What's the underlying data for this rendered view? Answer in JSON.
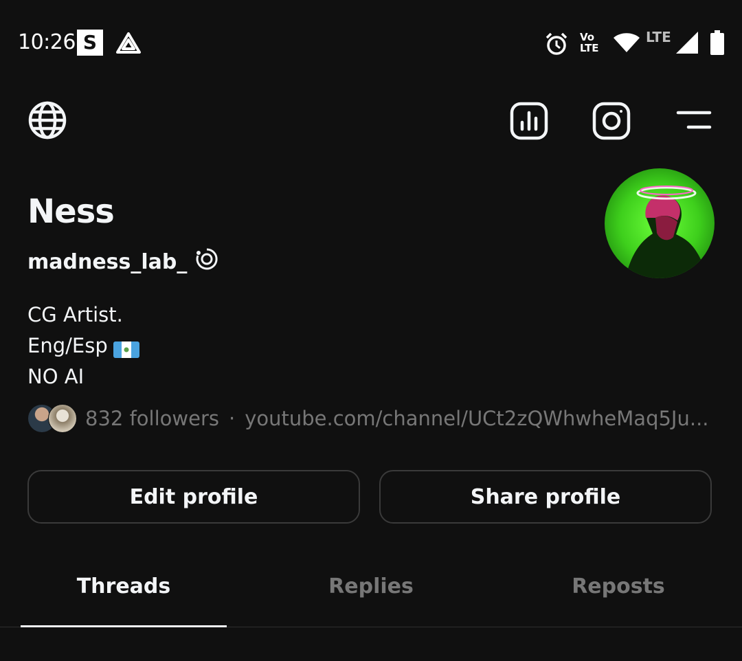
{
  "status_bar": {
    "time": "10:26",
    "s_icon_label": "S",
    "volte_top": "Vo",
    "volte_bottom": "LTE",
    "lte_label": "LTE",
    "icons": [
      "drive-icon",
      "alarm-icon",
      "volte-icon",
      "wifi-icon",
      "signal-icon",
      "battery-icon"
    ]
  },
  "header": {
    "icons": [
      "globe-icon",
      "insights-icon",
      "instagram-icon",
      "menu-icon"
    ]
  },
  "profile": {
    "display_name": "Ness",
    "username": "madness_lab_",
    "bio_lines": [
      "CG Artist.",
      "Eng/Esp",
      "NO AI"
    ],
    "followers": "832 followers",
    "separator": "·",
    "link": "youtube.com/channel/UCt2zQWhwheMaq5Ju..."
  },
  "buttons": {
    "edit": "Edit profile",
    "share": "Share profile"
  },
  "tabs": [
    {
      "label": "Threads",
      "active": true
    },
    {
      "label": "Replies",
      "active": false
    },
    {
      "label": "Reposts",
      "active": false
    }
  ],
  "colors": {
    "background": "#101010",
    "text_primary": "#f3f5f7",
    "text_secondary": "#777777",
    "border": "#3a3a3a",
    "avatar_green": "#3ecf1c"
  }
}
